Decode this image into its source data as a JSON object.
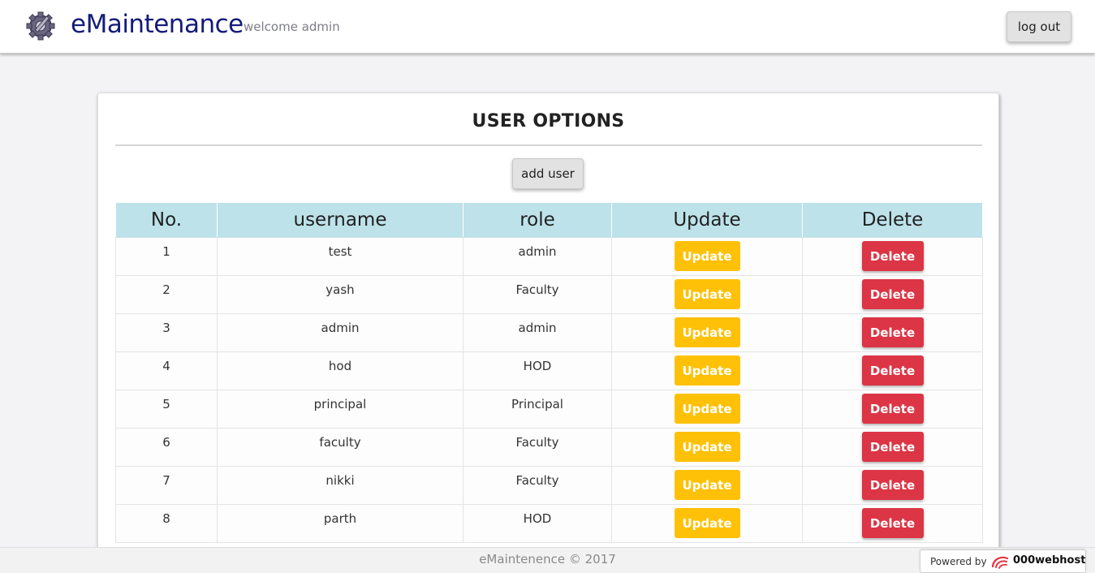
{
  "header": {
    "brand": "eMaintenance",
    "welcome": "welcome admin",
    "logout_label": "log out"
  },
  "card": {
    "title": "USER OPTIONS",
    "add_user_label": "add user"
  },
  "table": {
    "columns": [
      "No.",
      "username",
      "role",
      "Update",
      "Delete"
    ],
    "rows": [
      {
        "no": "1",
        "username": "test",
        "role": "admin",
        "update": "Update",
        "delete": "Delete"
      },
      {
        "no": "2",
        "username": "yash",
        "role": "Faculty",
        "update": "Update",
        "delete": "Delete"
      },
      {
        "no": "3",
        "username": "admin",
        "role": "admin",
        "update": "Update",
        "delete": "Delete"
      },
      {
        "no": "4",
        "username": "hod",
        "role": "HOD",
        "update": "Update",
        "delete": "Delete"
      },
      {
        "no": "5",
        "username": "principal",
        "role": "Principal",
        "update": "Update",
        "delete": "Delete"
      },
      {
        "no": "6",
        "username": "faculty",
        "role": "Faculty",
        "update": "Update",
        "delete": "Delete"
      },
      {
        "no": "7",
        "username": "nikki",
        "role": "Faculty",
        "update": "Update",
        "delete": "Delete"
      },
      {
        "no": "8",
        "username": "parth",
        "role": "HOD",
        "update": "Update",
        "delete": "Delete"
      }
    ]
  },
  "footer": {
    "text": "eMaintenence © 2017"
  },
  "powered_by": {
    "label": "Powered by",
    "brand": "000webhost",
    "icon": "webhost-swirl-icon"
  },
  "icons": {
    "logo": "gear-wrench-icon"
  },
  "colors": {
    "brand": "#141b7a",
    "header_row": "#bde2ea",
    "update_button": "#ffc107",
    "delete_button": "#dc3545"
  }
}
